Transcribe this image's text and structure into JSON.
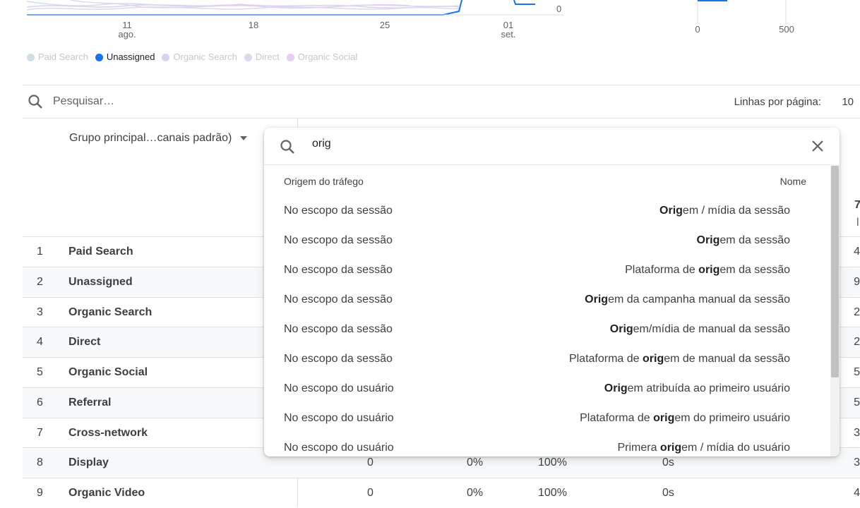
{
  "chart": {
    "x_ticks": [
      {
        "day": "11",
        "month": "ago."
      },
      {
        "day": "18",
        "month": ""
      },
      {
        "day": "25",
        "month": ""
      },
      {
        "day": "01",
        "month": "set."
      }
    ],
    "y_tick_main": "0",
    "bar_x_ticks": [
      "0",
      "500"
    ],
    "colors": {
      "unassigned": "#1a73e8",
      "paid": "#cfe0e4",
      "organic_search": "#d6d3f0",
      "direct": "#ddd7f2",
      "organic_social": "#e7cdee"
    }
  },
  "legend": [
    {
      "label": "Paid Search",
      "color": "#cfe0e4",
      "active": false
    },
    {
      "label": "Unassigned",
      "color": "#1a73e8",
      "active": true
    },
    {
      "label": "Organic Search",
      "color": "#d6d3f0",
      "active": false
    },
    {
      "label": "Direct",
      "color": "#ddd7f2",
      "active": false
    },
    {
      "label": "Organic Social",
      "color": "#e7cdee",
      "active": false
    }
  ],
  "search": {
    "placeholder": "Pesquisar…"
  },
  "pagination": {
    "rows_label": "Linhas por página:",
    "rows_value": "10"
  },
  "table": {
    "dimension_label": "Grupo principal…canais padrão)",
    "rows": [
      {
        "num": "1",
        "name": "Paid Search",
        "end": "4"
      },
      {
        "num": "2",
        "name": "Unassigned",
        "end": "9"
      },
      {
        "num": "3",
        "name": "Organic Search",
        "end": "2"
      },
      {
        "num": "4",
        "name": "Direct",
        "end": "2"
      },
      {
        "num": "5",
        "name": "Organic Social",
        "end": "5"
      },
      {
        "num": "6",
        "name": "Referral",
        "end": "5"
      },
      {
        "num": "7",
        "name": "Cross-network",
        "end": "3"
      },
      {
        "num": "8",
        "name": "Display",
        "c1": "0",
        "c2": "0%",
        "c3": "100%",
        "c4": "0s",
        "end": "3"
      },
      {
        "num": "9",
        "name": "Organic Video",
        "c1": "0",
        "c2": "0%",
        "c3": "100%",
        "c4": "0s",
        "end": "4"
      }
    ],
    "header_fragments": [
      "7",
      "l"
    ]
  },
  "dropdown": {
    "query": "orig",
    "col_scope": "Origem do tráfego",
    "col_name": "Nome",
    "items": [
      {
        "scope": "No escopo da sessão",
        "pre": "",
        "bold": "Orig",
        "post": "em / mídia da sessão"
      },
      {
        "scope": "No escopo da sessão",
        "pre": "",
        "bold": "Orig",
        "post": "em da sessão"
      },
      {
        "scope": "No escopo da sessão",
        "pre": "Plataforma de ",
        "bold": "orig",
        "post": "em da sessão"
      },
      {
        "scope": "No escopo da sessão",
        "pre": "",
        "bold": "Orig",
        "post": "em da campanha manual da sessão"
      },
      {
        "scope": "No escopo da sessão",
        "pre": "",
        "bold": "Orig",
        "post": "em/mídia de manual da sessão"
      },
      {
        "scope": "No escopo da sessão",
        "pre": "Plataforma de ",
        "bold": "orig",
        "post": "em de manual da sessão"
      },
      {
        "scope": "No escopo do usuário",
        "pre": "",
        "bold": "Orig",
        "post": "em atribuída ao primeiro usuário"
      },
      {
        "scope": "No escopo do usuário",
        "pre": "Plataforma de ",
        "bold": "orig",
        "post": "em do primeiro usuário"
      },
      {
        "scope": "No escopo do usuário",
        "pre": "Primera ",
        "bold": "orig",
        "post": "em / mídia do usuário"
      }
    ]
  }
}
